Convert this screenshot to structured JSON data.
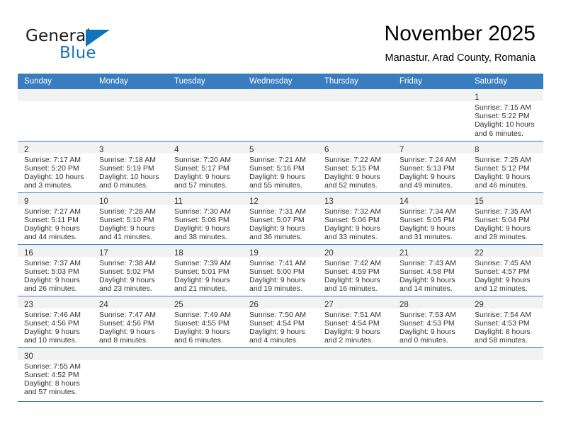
{
  "brand": {
    "name_part1": "General",
    "name_part2": "Blue",
    "logo_icon": "blue-triangle-icon",
    "accent_color": "#1273bd"
  },
  "header": {
    "title": "November 2025",
    "subtitle": "Manastur, Arad County, Romania"
  },
  "theme": {
    "header_row_color": "#3a7cc0",
    "daynum_band_color": "#f2f2f2",
    "row_divider_color": "#3a7cc0",
    "text_color": "#333333"
  },
  "weekday_headers": [
    "Sunday",
    "Monday",
    "Tuesday",
    "Wednesday",
    "Thursday",
    "Friday",
    "Saturday"
  ],
  "weeks": [
    {
      "days": [
        {
          "empty": true
        },
        {
          "empty": true
        },
        {
          "empty": true
        },
        {
          "empty": true
        },
        {
          "empty": true
        },
        {
          "empty": true
        },
        {
          "empty": false,
          "daynum": "1",
          "sunrise": "Sunrise: 7:15 AM",
          "sunset": "Sunset: 5:22 PM",
          "daylight_line1": "Daylight: 10 hours",
          "daylight_line2": "and 6 minutes."
        }
      ]
    },
    {
      "days": [
        {
          "empty": false,
          "daynum": "2",
          "sunrise": "Sunrise: 7:17 AM",
          "sunset": "Sunset: 5:20 PM",
          "daylight_line1": "Daylight: 10 hours",
          "daylight_line2": "and 3 minutes."
        },
        {
          "empty": false,
          "daynum": "3",
          "sunrise": "Sunrise: 7:18 AM",
          "sunset": "Sunset: 5:19 PM",
          "daylight_line1": "Daylight: 10 hours",
          "daylight_line2": "and 0 minutes."
        },
        {
          "empty": false,
          "daynum": "4",
          "sunrise": "Sunrise: 7:20 AM",
          "sunset": "Sunset: 5:17 PM",
          "daylight_line1": "Daylight: 9 hours",
          "daylight_line2": "and 57 minutes."
        },
        {
          "empty": false,
          "daynum": "5",
          "sunrise": "Sunrise: 7:21 AM",
          "sunset": "Sunset: 5:16 PM",
          "daylight_line1": "Daylight: 9 hours",
          "daylight_line2": "and 55 minutes."
        },
        {
          "empty": false,
          "daynum": "6",
          "sunrise": "Sunrise: 7:22 AM",
          "sunset": "Sunset: 5:15 PM",
          "daylight_line1": "Daylight: 9 hours",
          "daylight_line2": "and 52 minutes."
        },
        {
          "empty": false,
          "daynum": "7",
          "sunrise": "Sunrise: 7:24 AM",
          "sunset": "Sunset: 5:13 PM",
          "daylight_line1": "Daylight: 9 hours",
          "daylight_line2": "and 49 minutes."
        },
        {
          "empty": false,
          "daynum": "8",
          "sunrise": "Sunrise: 7:25 AM",
          "sunset": "Sunset: 5:12 PM",
          "daylight_line1": "Daylight: 9 hours",
          "daylight_line2": "and 46 minutes."
        }
      ]
    },
    {
      "days": [
        {
          "empty": false,
          "daynum": "9",
          "sunrise": "Sunrise: 7:27 AM",
          "sunset": "Sunset: 5:11 PM",
          "daylight_line1": "Daylight: 9 hours",
          "daylight_line2": "and 44 minutes."
        },
        {
          "empty": false,
          "daynum": "10",
          "sunrise": "Sunrise: 7:28 AM",
          "sunset": "Sunset: 5:10 PM",
          "daylight_line1": "Daylight: 9 hours",
          "daylight_line2": "and 41 minutes."
        },
        {
          "empty": false,
          "daynum": "11",
          "sunrise": "Sunrise: 7:30 AM",
          "sunset": "Sunset: 5:08 PM",
          "daylight_line1": "Daylight: 9 hours",
          "daylight_line2": "and 38 minutes."
        },
        {
          "empty": false,
          "daynum": "12",
          "sunrise": "Sunrise: 7:31 AM",
          "sunset": "Sunset: 5:07 PM",
          "daylight_line1": "Daylight: 9 hours",
          "daylight_line2": "and 36 minutes."
        },
        {
          "empty": false,
          "daynum": "13",
          "sunrise": "Sunrise: 7:32 AM",
          "sunset": "Sunset: 5:06 PM",
          "daylight_line1": "Daylight: 9 hours",
          "daylight_line2": "and 33 minutes."
        },
        {
          "empty": false,
          "daynum": "14",
          "sunrise": "Sunrise: 7:34 AM",
          "sunset": "Sunset: 5:05 PM",
          "daylight_line1": "Daylight: 9 hours",
          "daylight_line2": "and 31 minutes."
        },
        {
          "empty": false,
          "daynum": "15",
          "sunrise": "Sunrise: 7:35 AM",
          "sunset": "Sunset: 5:04 PM",
          "daylight_line1": "Daylight: 9 hours",
          "daylight_line2": "and 28 minutes."
        }
      ]
    },
    {
      "days": [
        {
          "empty": false,
          "daynum": "16",
          "sunrise": "Sunrise: 7:37 AM",
          "sunset": "Sunset: 5:03 PM",
          "daylight_line1": "Daylight: 9 hours",
          "daylight_line2": "and 26 minutes."
        },
        {
          "empty": false,
          "daynum": "17",
          "sunrise": "Sunrise: 7:38 AM",
          "sunset": "Sunset: 5:02 PM",
          "daylight_line1": "Daylight: 9 hours",
          "daylight_line2": "and 23 minutes."
        },
        {
          "empty": false,
          "daynum": "18",
          "sunrise": "Sunrise: 7:39 AM",
          "sunset": "Sunset: 5:01 PM",
          "daylight_line1": "Daylight: 9 hours",
          "daylight_line2": "and 21 minutes."
        },
        {
          "empty": false,
          "daynum": "19",
          "sunrise": "Sunrise: 7:41 AM",
          "sunset": "Sunset: 5:00 PM",
          "daylight_line1": "Daylight: 9 hours",
          "daylight_line2": "and 19 minutes."
        },
        {
          "empty": false,
          "daynum": "20",
          "sunrise": "Sunrise: 7:42 AM",
          "sunset": "Sunset: 4:59 PM",
          "daylight_line1": "Daylight: 9 hours",
          "daylight_line2": "and 16 minutes."
        },
        {
          "empty": false,
          "daynum": "21",
          "sunrise": "Sunrise: 7:43 AM",
          "sunset": "Sunset: 4:58 PM",
          "daylight_line1": "Daylight: 9 hours",
          "daylight_line2": "and 14 minutes."
        },
        {
          "empty": false,
          "daynum": "22",
          "sunrise": "Sunrise: 7:45 AM",
          "sunset": "Sunset: 4:57 PM",
          "daylight_line1": "Daylight: 9 hours",
          "daylight_line2": "and 12 minutes."
        }
      ]
    },
    {
      "days": [
        {
          "empty": false,
          "daynum": "23",
          "sunrise": "Sunrise: 7:46 AM",
          "sunset": "Sunset: 4:56 PM",
          "daylight_line1": "Daylight: 9 hours",
          "daylight_line2": "and 10 minutes."
        },
        {
          "empty": false,
          "daynum": "24",
          "sunrise": "Sunrise: 7:47 AM",
          "sunset": "Sunset: 4:56 PM",
          "daylight_line1": "Daylight: 9 hours",
          "daylight_line2": "and 8 minutes."
        },
        {
          "empty": false,
          "daynum": "25",
          "sunrise": "Sunrise: 7:49 AM",
          "sunset": "Sunset: 4:55 PM",
          "daylight_line1": "Daylight: 9 hours",
          "daylight_line2": "and 6 minutes."
        },
        {
          "empty": false,
          "daynum": "26",
          "sunrise": "Sunrise: 7:50 AM",
          "sunset": "Sunset: 4:54 PM",
          "daylight_line1": "Daylight: 9 hours",
          "daylight_line2": "and 4 minutes."
        },
        {
          "empty": false,
          "daynum": "27",
          "sunrise": "Sunrise: 7:51 AM",
          "sunset": "Sunset: 4:54 PM",
          "daylight_line1": "Daylight: 9 hours",
          "daylight_line2": "and 2 minutes."
        },
        {
          "empty": false,
          "daynum": "28",
          "sunrise": "Sunrise: 7:53 AM",
          "sunset": "Sunset: 4:53 PM",
          "daylight_line1": "Daylight: 9 hours",
          "daylight_line2": "and 0 minutes."
        },
        {
          "empty": false,
          "daynum": "29",
          "sunrise": "Sunrise: 7:54 AM",
          "sunset": "Sunset: 4:53 PM",
          "daylight_line1": "Daylight: 8 hours",
          "daylight_line2": "and 58 minutes."
        }
      ]
    },
    {
      "days": [
        {
          "empty": false,
          "daynum": "30",
          "sunrise": "Sunrise: 7:55 AM",
          "sunset": "Sunset: 4:52 PM",
          "daylight_line1": "Daylight: 8 hours",
          "daylight_line2": "and 57 minutes."
        },
        {
          "empty": true
        },
        {
          "empty": true
        },
        {
          "empty": true
        },
        {
          "empty": true
        },
        {
          "empty": true
        },
        {
          "empty": true
        }
      ]
    }
  ]
}
